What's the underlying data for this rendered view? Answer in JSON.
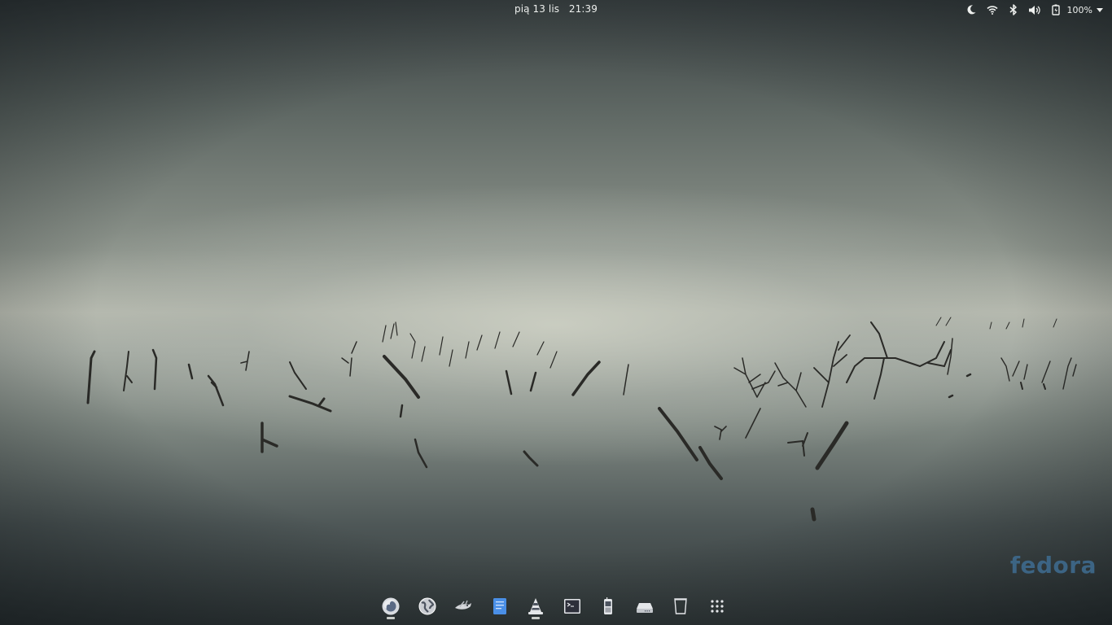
{
  "topbar": {
    "clock_day": "pią 13 lis",
    "clock_time": "21:39",
    "battery_percent": "100%",
    "tray_icons": [
      "night-light-icon",
      "wifi-icon",
      "bluetooth-icon",
      "volume-icon",
      "battery-icon",
      "dropdown-arrow-icon"
    ]
  },
  "watermark": {
    "text": "fedora",
    "color": "#3f6d92"
  },
  "dock": {
    "items": [
      {
        "name": "firefox",
        "running": true
      },
      {
        "name": "web-browser",
        "running": false
      },
      {
        "name": "gimp",
        "running": false
      },
      {
        "name": "text-editor",
        "running": false
      },
      {
        "name": "vlc",
        "running": true
      },
      {
        "name": "terminal",
        "running": false
      },
      {
        "name": "gsconnect-phone",
        "running": false
      },
      {
        "name": "drive",
        "running": false
      },
      {
        "name": "trash",
        "running": false
      },
      {
        "name": "show-applications",
        "running": false
      }
    ]
  },
  "colors": {
    "text": "#eef0ee",
    "accent": "#4a8fe7"
  }
}
